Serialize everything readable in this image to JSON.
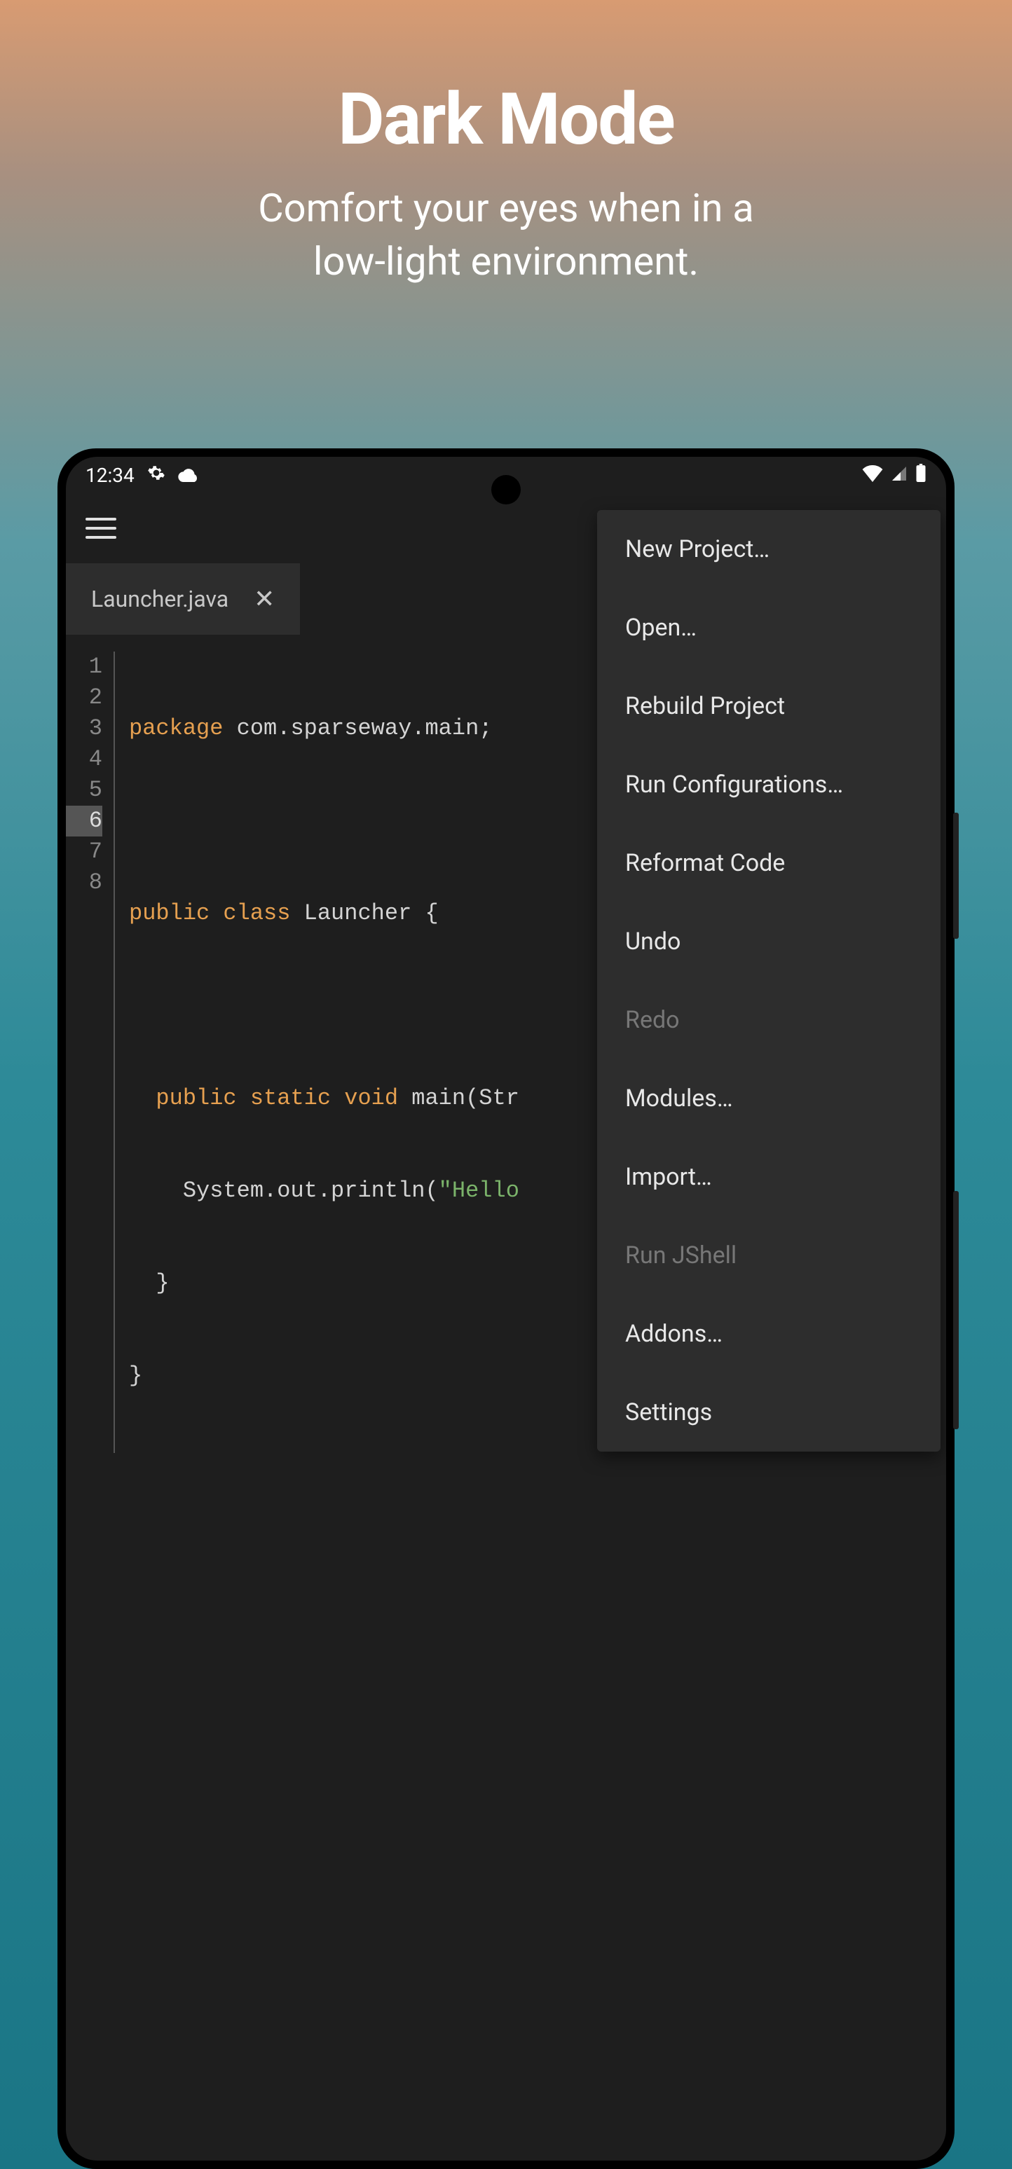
{
  "hero": {
    "title": "Dark Mode",
    "subtitle_line1": "Comfort your eyes when in a",
    "subtitle_line2": "low-light environment."
  },
  "status": {
    "time": "12:34"
  },
  "tab": {
    "filename": "Launcher.java"
  },
  "code": {
    "lines": [
      "1",
      "2",
      "3",
      "4",
      "5",
      "6",
      "7",
      "8"
    ],
    "l1_kw": "package",
    "l1_rest": " com.sparseway.main;",
    "l3_kw1": "public",
    "l3_kw2": "class",
    "l3_rest": " Launcher {",
    "l5_kw1": "public",
    "l5_kw2": "static",
    "l5_kw3": "void",
    "l5_rest": " main(Str",
    "l6_pre": "    System.out.println(",
    "l6_str": "\"Hello",
    "l7": "  }",
    "l8": "}"
  },
  "menu": {
    "items": [
      {
        "label": "New Project…",
        "disabled": false
      },
      {
        "label": "Open…",
        "disabled": false
      },
      {
        "label": "Rebuild Project",
        "disabled": false
      },
      {
        "label": "Run Configurations…",
        "disabled": false
      },
      {
        "label": "Reformat Code",
        "disabled": false
      },
      {
        "label": "Undo",
        "disabled": false
      },
      {
        "label": "Redo",
        "disabled": true
      },
      {
        "label": "Modules…",
        "disabled": false
      },
      {
        "label": "Import…",
        "disabled": false
      },
      {
        "label": "Run JShell",
        "disabled": true
      },
      {
        "label": "Addons…",
        "disabled": false
      },
      {
        "label": "Settings",
        "disabled": false
      }
    ]
  }
}
